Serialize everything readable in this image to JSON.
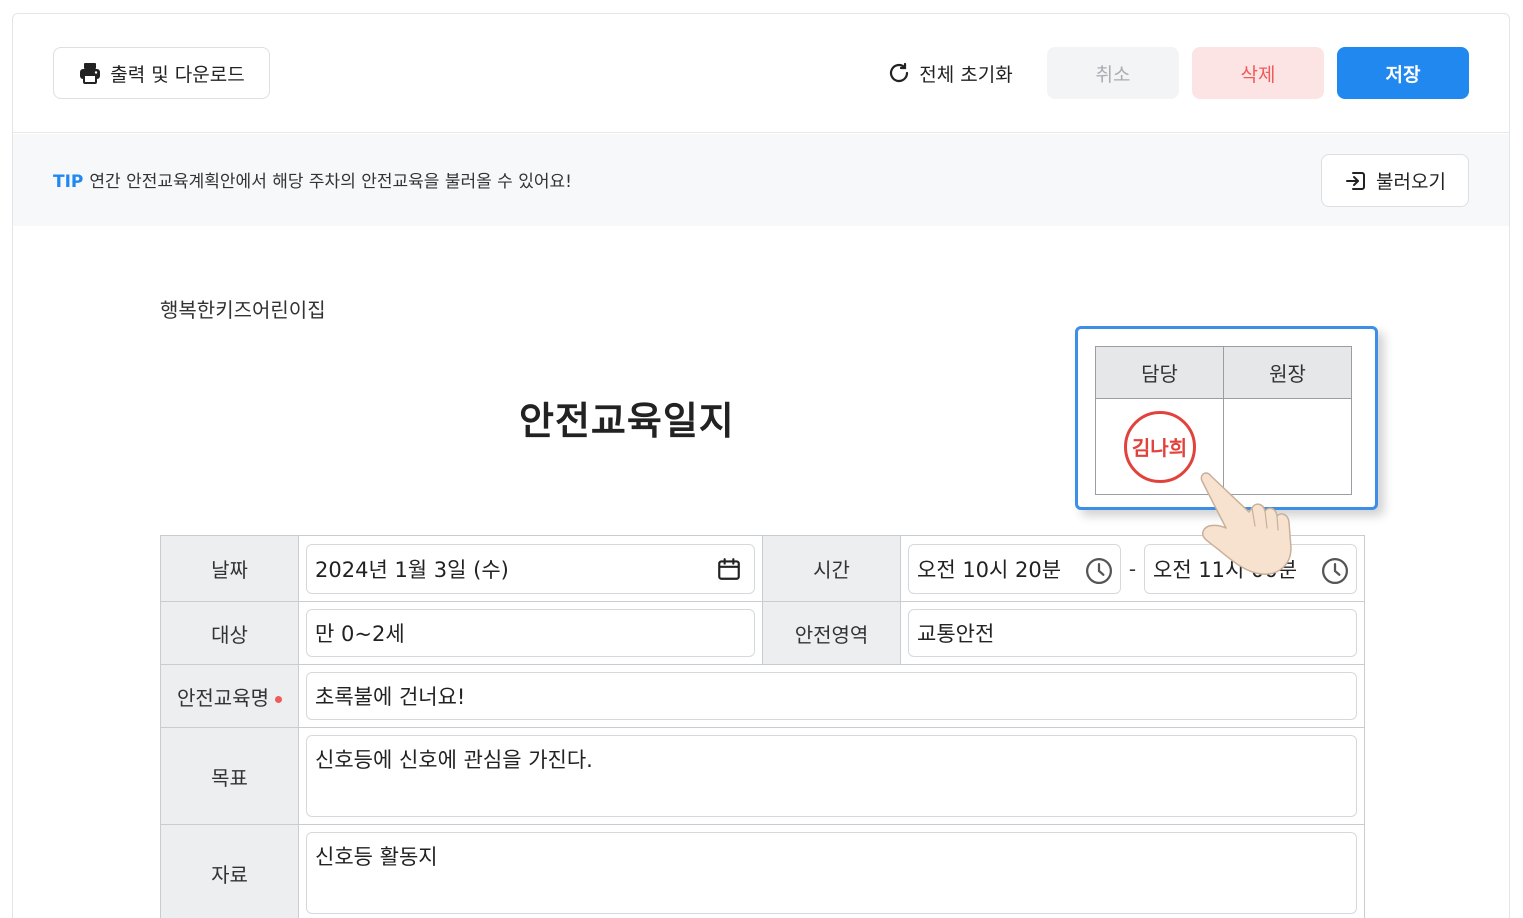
{
  "toolbar": {
    "print_label": "출력 및 다운로드",
    "reset_label": "전체 초기화",
    "cancel_label": "취소",
    "delete_label": "삭제",
    "save_label": "저장"
  },
  "tip": {
    "label": "TIP",
    "text": "연간 안전교육계획안에서 해당 주차의 안전교육을 불러올 수 있어요!",
    "load_label": "불러오기"
  },
  "document": {
    "org_name": "행복한키즈어린이집",
    "title": "안전교육일지"
  },
  "approval": {
    "col1_header": "담당",
    "col2_header": "원장",
    "stamp_name": "김나희",
    "col2_value": ""
  },
  "form": {
    "date_label": "날짜",
    "date_value": "2024년 1월 3일 (수)",
    "time_label": "시간",
    "time_start": "오전 10시 20분",
    "time_separator": "-",
    "time_end": "오전 11시 00분",
    "target_label": "대상",
    "target_value": "만 0~2세",
    "area_label": "안전영역",
    "area_value": "교통안전",
    "name_label": "안전교육명",
    "name_value": "초록불에 건너요!",
    "goal_label": "목표",
    "goal_value": "신호등에 신호에 관심을 가진다.",
    "material_label": "자료",
    "material_value": "신호등 활동지"
  },
  "colors": {
    "primary": "#2188f0",
    "danger": "#ef5b5b",
    "stamp": "#e2423c"
  },
  "icons": {
    "print": "printer-icon",
    "reset": "refresh-icon",
    "load": "import-icon",
    "calendar": "calendar-icon",
    "clock": "clock-icon",
    "hand": "pointing-hand-icon"
  }
}
